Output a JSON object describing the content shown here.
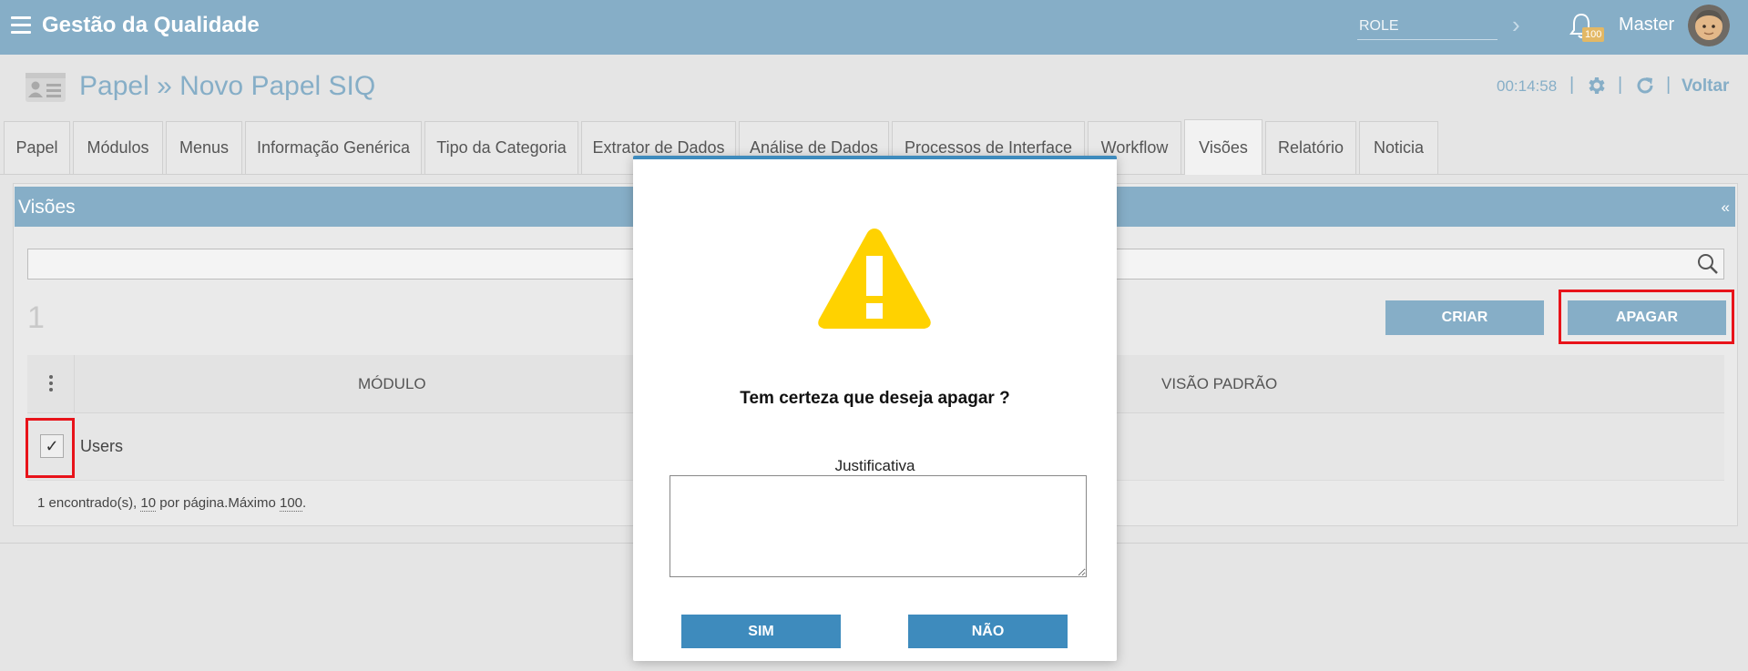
{
  "header": {
    "app_title": "Gestão da Qualidade",
    "role_placeholder": "ROLE",
    "notification_count": "100",
    "user_name": "Master"
  },
  "page": {
    "title": "Papel » Novo Papel SIQ",
    "timer": "00:14:58",
    "back_label": "Voltar",
    "separator": "|"
  },
  "tabs": [
    {
      "label": "Papel"
    },
    {
      "label": "Módulos"
    },
    {
      "label": "Menus"
    },
    {
      "label": "Informação Genérica"
    },
    {
      "label": "Tipo da Categoria"
    },
    {
      "label": "Extrator de Dados"
    },
    {
      "label": "Análise de Dados"
    },
    {
      "label": "Processos de Interface"
    },
    {
      "label": "Workflow"
    },
    {
      "label": "Visões"
    },
    {
      "label": "Relatório"
    },
    {
      "label": "Noticia"
    }
  ],
  "active_tab": "Visões",
  "panel": {
    "title": "Visões",
    "collapse": "«",
    "count": "1",
    "create_label": "CRIAR",
    "delete_label": "APAGAR",
    "columns": [
      "MÓDULO",
      "VISÃO PADRÃO"
    ],
    "rows": [
      {
        "module": "Users",
        "checked": "✓"
      }
    ],
    "footer": {
      "found": "1 encontrado(s), ",
      "per_page_value": "10",
      "per_page_text": " por página.Máximo ",
      "max_value": "100",
      "end": "."
    }
  },
  "modal": {
    "question": "Tem certeza que deseja apagar ?",
    "justification_label": "Justificativa",
    "justification_value": "",
    "yes_label": "SIM",
    "no_label": "NÃO"
  },
  "colors": {
    "header_bg": "#86aec7",
    "modal_button": "#3e8bbd",
    "warning": "#ffd200",
    "highlight": "#e8131a"
  }
}
